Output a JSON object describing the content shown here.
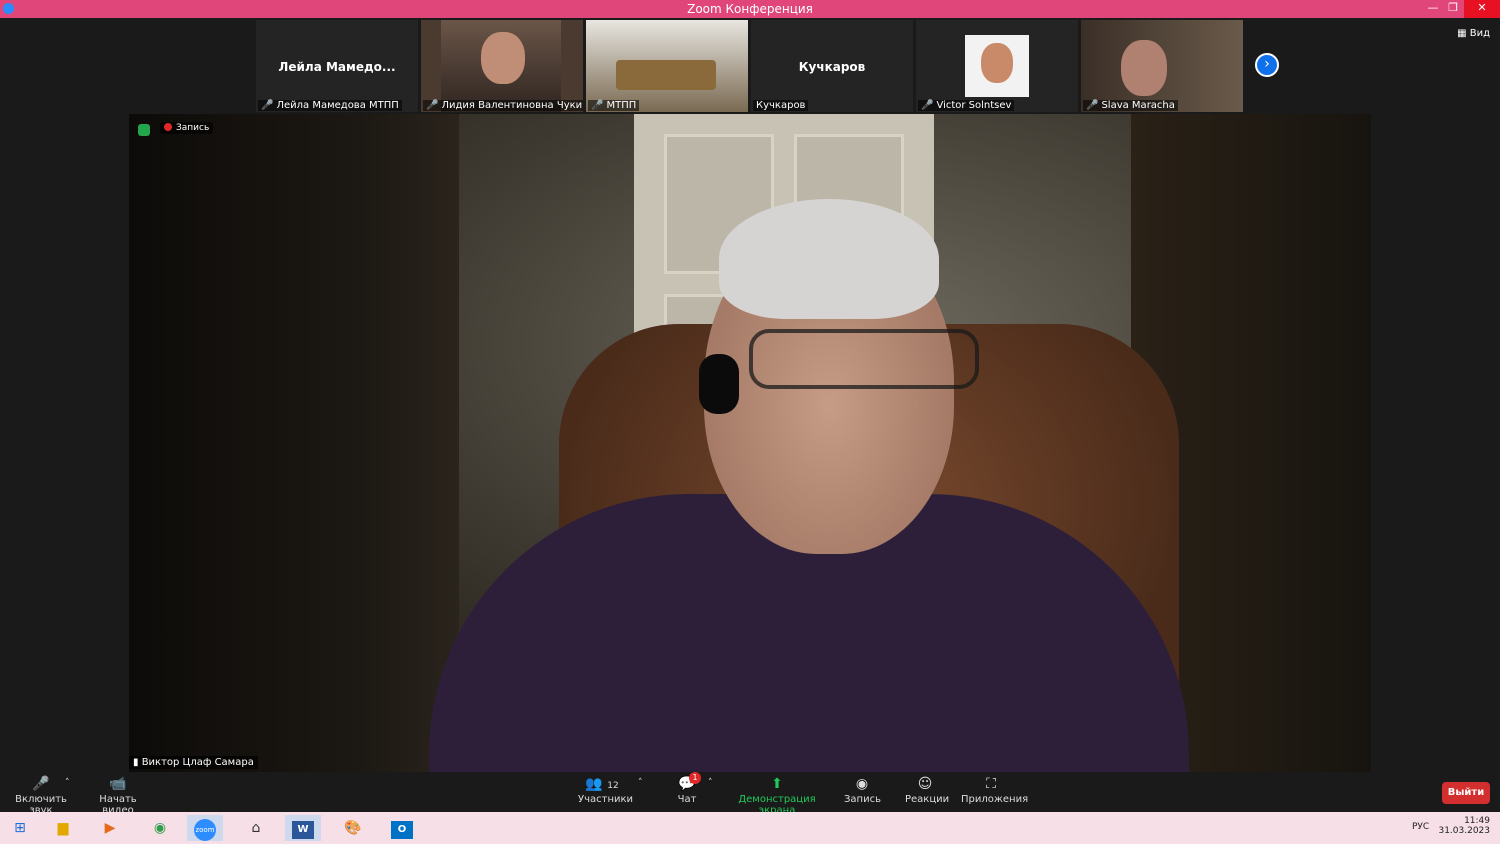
{
  "window": {
    "title": "Zoom Конференция"
  },
  "view_label": "Вид",
  "thumbnails": [
    {
      "display_name": "Лейла  Мамедо...",
      "label": "Лейла Мамедова МТПП"
    },
    {
      "display_name": "",
      "label": "Лидия Валентиновна Чукина"
    },
    {
      "display_name": "",
      "label": "МТПП"
    },
    {
      "display_name": "Кучкаров",
      "label": "Кучкаров"
    },
    {
      "display_name": "",
      "label": "Victor Solntsev"
    },
    {
      "display_name": "",
      "label": "Slava Maracha"
    }
  ],
  "main": {
    "recording_label": "Запись",
    "speaker_name": "Виктор Цлаф Самара"
  },
  "toolbar": {
    "unmute": "Включить звук",
    "start_video": "Начать видео",
    "participants": "Участники",
    "participants_count": "12",
    "chat": "Чат",
    "chat_badge": "1",
    "share_screen": "Демонстрация экрана",
    "record": "Запись",
    "reactions": "Реакции",
    "apps": "Приложения",
    "leave": "Выйти"
  },
  "taskbar": {
    "lang": "РУС",
    "time": "11:49",
    "date": "31.03.2023"
  }
}
